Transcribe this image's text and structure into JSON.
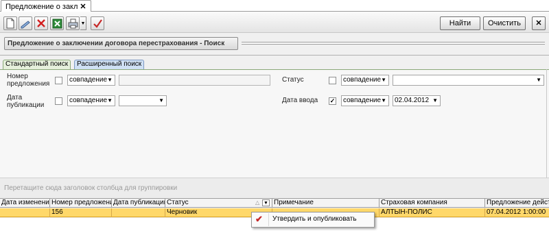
{
  "document_tab": {
    "label": "Предложение о закл",
    "close": "✕"
  },
  "toolbar": {
    "icons": [
      "new-document-icon",
      "edit-icon",
      "delete-icon",
      "excel-export-icon",
      "print-icon",
      "approve-check-icon"
    ],
    "find_label": "Найти",
    "clear_label": "Очистить",
    "close_label": "✕"
  },
  "title": "Предложение о заключении договора перестрахования  -  Поиск",
  "search_tabs": {
    "standard": "Стандартный поиск",
    "extended": "Расширенный поиск"
  },
  "filters": {
    "proposal_number": {
      "label_1": "Номер",
      "label_2": "предложения",
      "checked": false,
      "mode": "совпадение",
      "value": ""
    },
    "publish_date": {
      "label_1": "Дата",
      "label_2": "публикации",
      "checked": false,
      "mode": "совпадение",
      "value": ""
    },
    "status": {
      "label": "Статус",
      "checked": false,
      "mode": "совпадение",
      "value": ""
    },
    "entry_date": {
      "label": "Дата ввода",
      "checked": true,
      "check_mark": "✓",
      "mode": "совпадение",
      "value": "02.04.2012"
    }
  },
  "group_hint": "Перетащите сюда заголовок столбца для группировки",
  "grid": {
    "columns": [
      "Дата изменения",
      "Номер предложения",
      "Дата публикации",
      "Статус",
      "Примечание",
      "Страховая компания",
      "Предложение действ"
    ],
    "rows": [
      {
        "change_date": "",
        "number": "156",
        "publish_date": "",
        "status": "Черновик",
        "note": "",
        "company": "АЛТЫН-ПОЛИС",
        "valid": "07.04.2012 1:00:00"
      }
    ]
  },
  "context_menu": {
    "item": "Утвердить и опубликовать",
    "icon": "approve-check-icon",
    "mark": "✔"
  },
  "colors": {
    "selected_row": "#ffd86a",
    "approve_icon": "#c62828"
  }
}
